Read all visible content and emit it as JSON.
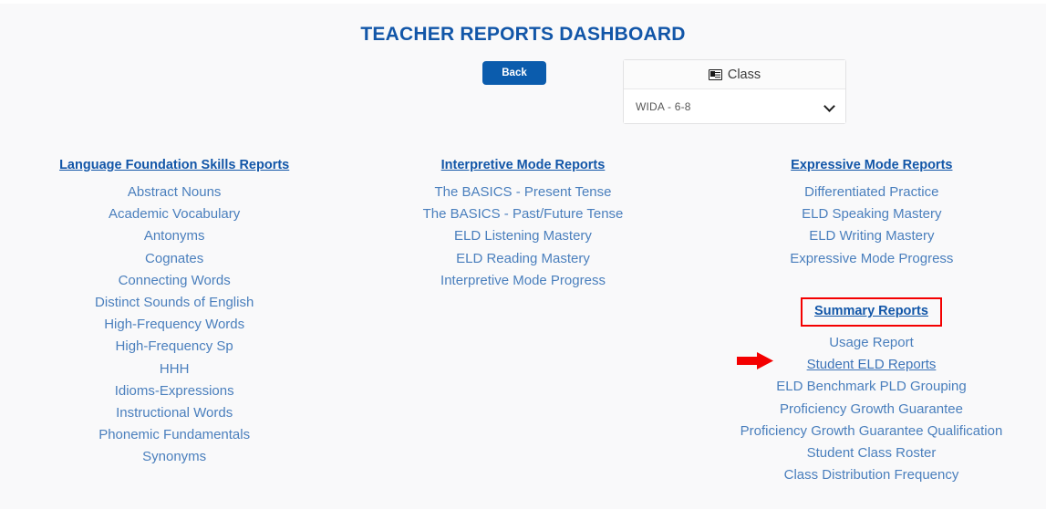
{
  "page": {
    "title": "TEACHER REPORTS DASHBOARD"
  },
  "toolbar": {
    "back_label": "Back"
  },
  "class_card": {
    "header_label": "Class",
    "icon": "id-card-icon",
    "selected_value": "WIDA - 6-8",
    "chevron_icon": "chevron-down-icon"
  },
  "columns": [
    {
      "heading": "Language Foundation Skills Reports",
      "links": [
        "Abstract Nouns",
        "Academic Vocabulary",
        "Antonyms",
        "Cognates",
        "Connecting Words",
        "Distinct Sounds of English",
        "High-Frequency Words",
        "High-Frequency Sp",
        "HHH",
        "Idioms-Expressions",
        "Instructional Words",
        "Phonemic Fundamentals",
        "Synonyms"
      ]
    },
    {
      "heading": "Interpretive Mode Reports",
      "links": [
        "The BASICS - Present Tense",
        "The BASICS - Past/Future Tense",
        "ELD Listening Mastery",
        "ELD Reading Mastery",
        "Interpretive Mode Progress"
      ]
    },
    {
      "heading": "Expressive Mode Reports",
      "links": [
        "Differentiated Practice",
        "ELD Speaking Mastery",
        "ELD Writing Mastery",
        "Expressive Mode Progress"
      ]
    }
  ],
  "summary": {
    "heading": "Summary Reports",
    "links": [
      "Usage Report",
      "Student ELD Reports",
      "ELD Benchmark PLD Grouping",
      "Proficiency Growth Guarantee",
      "Proficiency Growth Guarantee Qualification",
      "Student Class Roster",
      "Class Distribution Frequency"
    ],
    "highlighted_link": "Student ELD Reports",
    "annotation_icon": "red-arrow-icon"
  },
  "colors": {
    "title_blue": "#1256a8",
    "link_blue": "#4a7fbd",
    "button_blue": "#0b5cad",
    "annotation_red": "#f40000",
    "panel_background": "#f9f9fa"
  }
}
